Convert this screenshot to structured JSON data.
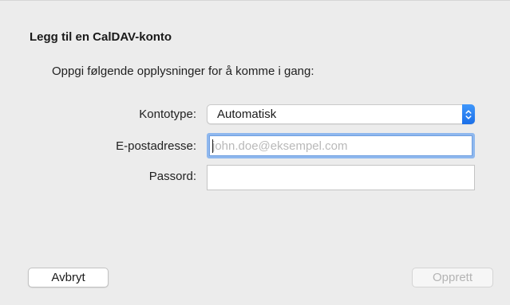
{
  "dialog": {
    "title": "Legg til en CalDAV-konto",
    "subtitle": "Oppgi følgende opplysninger for å komme i gang:"
  },
  "form": {
    "account_type": {
      "label": "Kontotype:",
      "value": "Automatisk"
    },
    "email": {
      "label": "E-postadresse:",
      "value": "",
      "placeholder": "john.doe@eksempel.com"
    },
    "password": {
      "label": "Passord:",
      "value": ""
    }
  },
  "buttons": {
    "cancel": "Avbryt",
    "create": "Opprett"
  },
  "colors": {
    "accent": "#1b6fe8",
    "focus_ring": "#8fb8ee"
  }
}
